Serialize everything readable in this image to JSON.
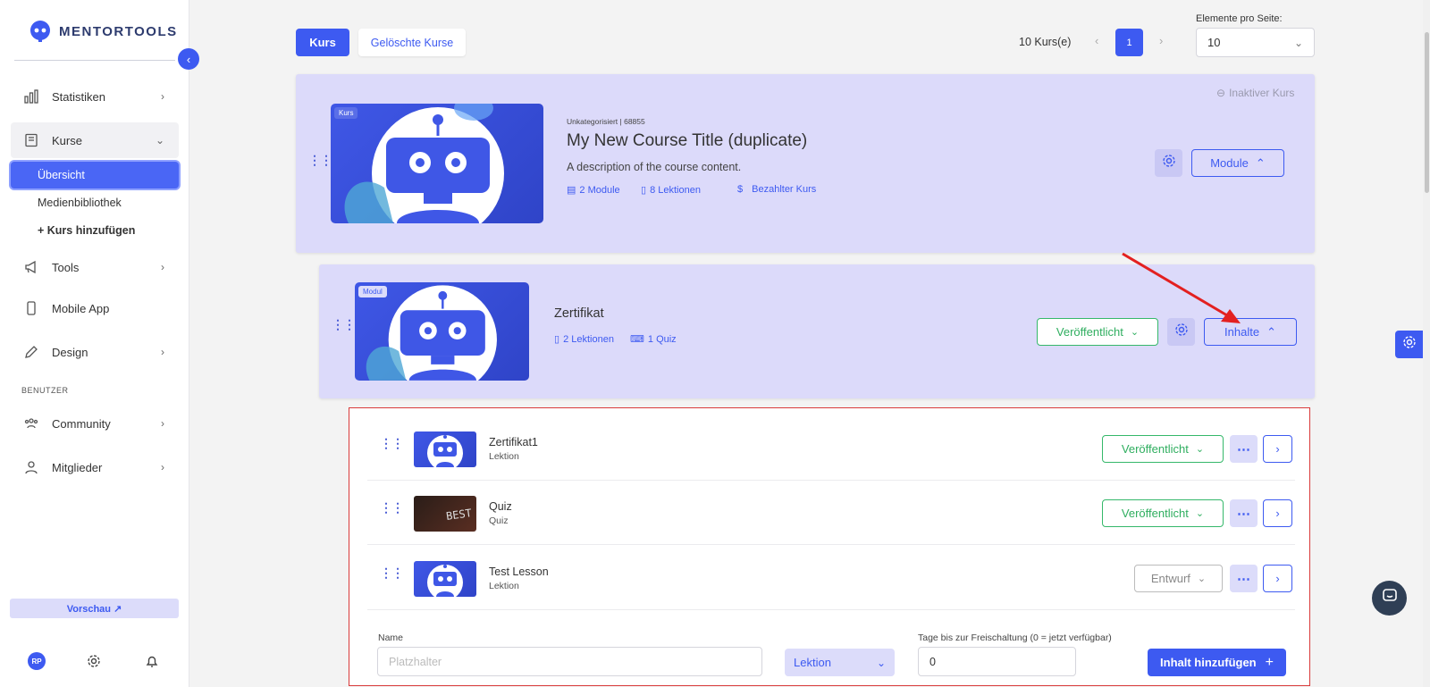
{
  "sidebar": {
    "logo": "MENTORTOOLS",
    "items": [
      {
        "label": "Statistiken"
      },
      {
        "label": "Kurse"
      },
      {
        "label": "Tools"
      },
      {
        "label": "Mobile App"
      },
      {
        "label": "Design"
      },
      {
        "label": "Community"
      },
      {
        "label": "Mitglieder"
      }
    ],
    "sub_items": [
      "Übersicht",
      "Medienbibliothek",
      "+ Kurs hinzufügen"
    ],
    "section_label": "BENUTZER",
    "preview_label": "Vorschau ↗",
    "avatar_initials": "RP"
  },
  "toolbar": {
    "tab_course": "Kurs",
    "tab_deleted": "Gelöschte Kurse",
    "course_count": "10 Kurs(e)",
    "current_page": "1",
    "per_page_label": "Elemente pro Seite:",
    "per_page_value": "10"
  },
  "course": {
    "tag": "Kurs",
    "meta": "Unkategorisiert | 68855",
    "title": "My New Course Title (duplicate)",
    "description": "A description of the course content.",
    "modules": "2 Module",
    "lessons": "8 Lektionen",
    "paid": "Bezahlter Kurs",
    "status": "Inaktiver Kurs",
    "modules_button": "Module"
  },
  "module": {
    "tag": "Modul",
    "title": "Zertifikat",
    "lessons": "2 Lektionen",
    "quiz": "1 Quiz",
    "status": "Veröffentlicht",
    "contents_button": "Inhalte"
  },
  "lessons": [
    {
      "title": "Zertifikat1",
      "type": "Lektion",
      "status": "Veröffentlicht"
    },
    {
      "title": "Quiz",
      "type": "Quiz",
      "status": "Veröffentlicht",
      "thumb_text": "BEST"
    },
    {
      "title": "Test Lesson",
      "type": "Lektion",
      "status": "Entwurf"
    }
  ],
  "add_form": {
    "name_label": "Name",
    "name_placeholder": "Platzhalter",
    "type_value": "Lektion",
    "days_label": "Tage bis zur Freischaltung (0 = jetzt verfügbar)",
    "days_value": "0",
    "submit_label": "Inhalt hinzufügen"
  },
  "colors": {
    "accent": "#3d5af1",
    "card_bg": "#dcdafa",
    "published": "#2fae5f",
    "highlight": "#d93a3a",
    "arrow": "#e32020"
  }
}
